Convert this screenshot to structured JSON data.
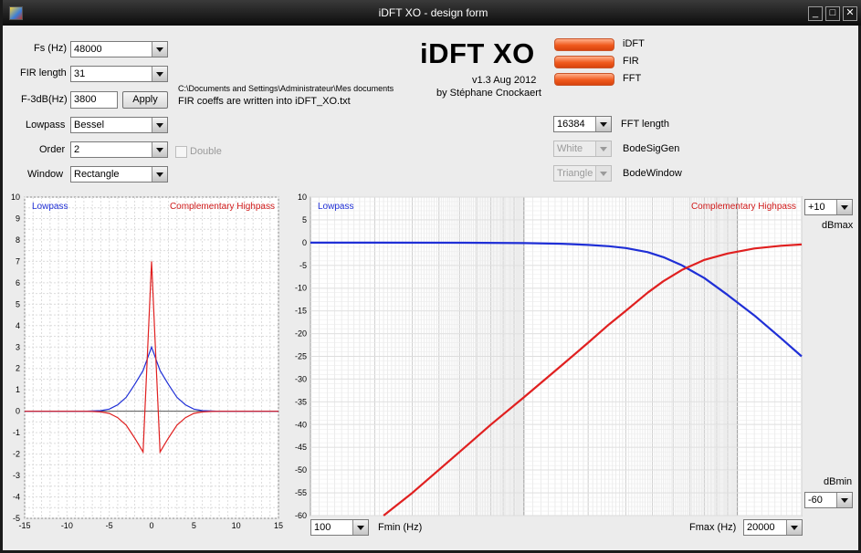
{
  "window": {
    "title": "iDFT XO - design form"
  },
  "settings": {
    "fs_label": "Fs (Hz)",
    "fs_value": "48000",
    "fir_length_label": "FIR length",
    "fir_length_value": "31",
    "f3db_label": "F-3dB(Hz)",
    "f3db_value": "3800",
    "apply_label": "Apply",
    "lowpass_label": "Lowpass",
    "lowpass_value": "Bessel",
    "order_label": "Order",
    "order_value": "2",
    "double_label": "Double",
    "window_label": "Window",
    "window_value": "Rectangle"
  },
  "info": {
    "path": "C:\\Documents and Settings\\Administrateur\\Mes documents",
    "coeffs_note": "FIR coeffs are written into iDFT_XO.txt"
  },
  "header": {
    "app_name": "iDFT XO",
    "version": "v1.3 Aug 2012",
    "author": "by Stéphane Cnockaert"
  },
  "legend": [
    {
      "label": "iDFT",
      "color": "#f05a1e"
    },
    {
      "label": "FIR",
      "color": "#f05a1e"
    },
    {
      "label": "FFT",
      "color": "#f05a1e"
    }
  ],
  "fft": {
    "length_value": "16384",
    "length_label": "FFT length",
    "siggen_value": "White",
    "siggen_label": "BodeSigGen",
    "window_value": "Triangle",
    "window_label": "BodeWindow"
  },
  "bode_controls": {
    "dbmax_value": "+10",
    "dbmax_label": "dBmax",
    "dbmin_value": "-60",
    "dbmin_label": "dBmin",
    "fmin_value": "100",
    "fmin_label": "Fmin (Hz)",
    "fmax_label": "Fmax (Hz)",
    "fmax_value": "20000"
  },
  "chart_data": [
    {
      "type": "line",
      "xlim": [
        -15,
        15
      ],
      "ylim": [
        -5,
        10
      ],
      "x_ticks": [
        -15,
        -10,
        -5,
        0,
        5,
        10,
        15
      ],
      "y_ticks": [
        -5,
        -4,
        -3,
        -2,
        -1,
        0,
        1,
        2,
        3,
        4,
        5,
        6,
        7,
        8,
        9,
        10
      ],
      "grid": true,
      "series": [
        {
          "name": "Lowpass",
          "color": "#1f2fd6",
          "x": [
            -15,
            -14,
            -13,
            -12,
            -11,
            -10,
            -9,
            -8,
            -7,
            -6,
            -5,
            -4,
            -3,
            -2,
            -1,
            0,
            1,
            2,
            3,
            4,
            5,
            6,
            7,
            8,
            9,
            10,
            11,
            12,
            13,
            14,
            15
          ],
          "values": [
            0,
            0,
            0,
            0,
            0,
            0,
            0,
            0,
            0.01,
            0.03,
            0.1,
            0.3,
            0.65,
            1.25,
            1.9,
            3.0,
            1.9,
            1.25,
            0.65,
            0.3,
            0.1,
            0.03,
            0.01,
            0,
            0,
            0,
            0,
            0,
            0,
            0,
            0
          ]
        },
        {
          "name": "Complementary Highpass",
          "color": "#e02020",
          "x": [
            -15,
            -14,
            -13,
            -12,
            -11,
            -10,
            -9,
            -8,
            -7,
            -6,
            -5,
            -4,
            -3,
            -2,
            -1,
            0,
            1,
            2,
            3,
            4,
            5,
            6,
            7,
            8,
            9,
            10,
            11,
            12,
            13,
            14,
            15
          ],
          "values": [
            0,
            0,
            0,
            0,
            0,
            0,
            0,
            0,
            -0.01,
            -0.03,
            -0.1,
            -0.3,
            -0.65,
            -1.25,
            -1.9,
            7.0,
            -1.9,
            -1.25,
            -0.65,
            -0.3,
            -0.1,
            -0.03,
            -0.01,
            0,
            0,
            0,
            0,
            0,
            0,
            0,
            0
          ]
        }
      ]
    },
    {
      "type": "line",
      "x_scale": "log",
      "xlim": [
        100,
        20000
      ],
      "ylim": [
        -60,
        10
      ],
      "y_ticks": [
        -60,
        -55,
        -50,
        -45,
        -40,
        -35,
        -30,
        -25,
        -20,
        -15,
        -10,
        -5,
        0,
        5,
        10
      ],
      "grid": true,
      "series": [
        {
          "name": "Lowpass",
          "color": "#1f2fd6",
          "x": [
            100,
            200,
            500,
            1000,
            1500,
            2000,
            2500,
            3000,
            3800,
            4500,
            5500,
            7000,
            9000,
            12000,
            16000,
            20000
          ],
          "values": [
            0,
            0,
            -0.02,
            -0.1,
            -0.25,
            -0.5,
            -0.8,
            -1.2,
            -2.1,
            -3.2,
            -5.0,
            -7.8,
            -11.5,
            -16,
            -21,
            -25
          ]
        },
        {
          "name": "Complementary Highpass",
          "color": "#e02020",
          "x": [
            220,
            300,
            500,
            700,
            1000,
            1500,
            2000,
            2500,
            3000,
            3800,
            4500,
            5500,
            7000,
            9000,
            12000,
            16000,
            20000
          ],
          "values": [
            -60,
            -55,
            -46,
            -40,
            -34,
            -27,
            -22,
            -18,
            -15,
            -11,
            -8.5,
            -6,
            -3.8,
            -2.4,
            -1.3,
            -0.7,
            -0.4
          ]
        }
      ]
    }
  ],
  "chart_labels": {
    "impulse_left": "Lowpass",
    "impulse_right": "Complementary Highpass",
    "bode_left": "Lowpass",
    "bode_right": "Complementary Highpass"
  }
}
